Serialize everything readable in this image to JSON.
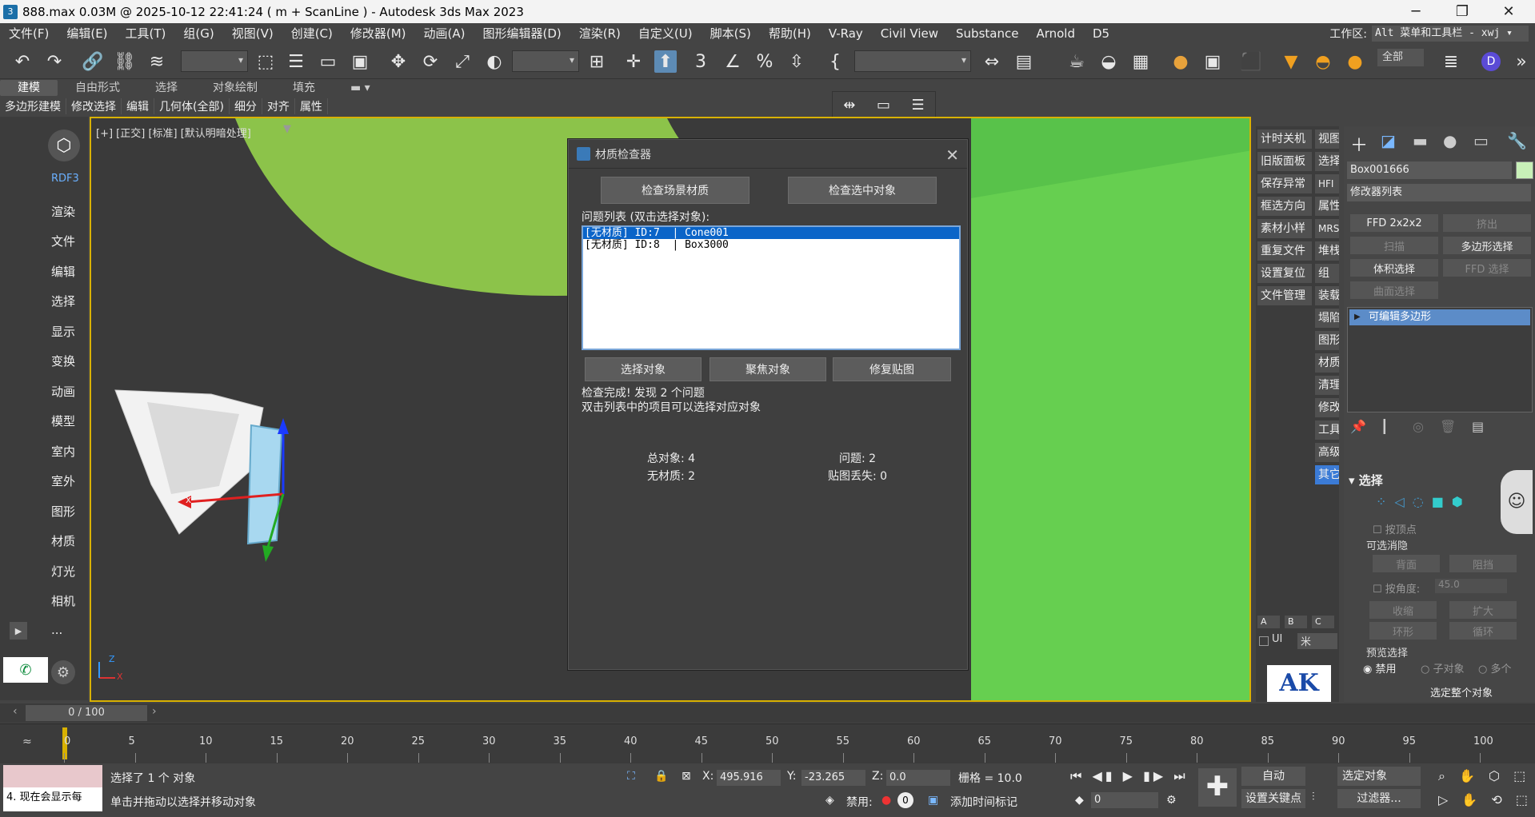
{
  "window": {
    "title": "888.max  0.03M @ 2025-10-12 22:41:24  ( m + ScanLine ) - Autodesk 3ds Max 2023",
    "minimize": "─",
    "maximize": "❐",
    "close": "✕"
  },
  "menu": {
    "items": [
      "文件(F)",
      "编辑(E)",
      "工具(T)",
      "组(G)",
      "视图(V)",
      "创建(C)",
      "修改器(M)",
      "动画(A)",
      "图形编辑器(D)",
      "渲染(R)",
      "自定义(U)",
      "脚本(S)",
      "帮助(H)",
      "V-Ray",
      "Civil View",
      "Substance",
      "Arnold",
      "D5"
    ],
    "workspace_label": "工作区:",
    "workspace_value": "Alt 菜单和工具栏 - xwj ▾"
  },
  "toolbar": {
    "all_label": "全部"
  },
  "ribbon": {
    "tabs": [
      "建模",
      "自由形式",
      "选择",
      "对象绘制",
      "填充"
    ],
    "sub_items": [
      "多边形建模",
      "修改选择",
      "编辑",
      "几何体(全部)",
      "细分",
      "对齐",
      "属性"
    ]
  },
  "left_panel": {
    "brand": "RDF3",
    "items": [
      "渲染",
      "文件",
      "编辑",
      "选择",
      "显示",
      "变换",
      "动画",
      "模型",
      "室内",
      "室外",
      "图形",
      "材质",
      "灯光",
      "相机",
      "..."
    ]
  },
  "viewport": {
    "label": "[+] [正交] [标准] [默认明暗处理]",
    "axis_x": "X",
    "axis_z": "Z",
    "gizmo_x": "x"
  },
  "dialog": {
    "title": "材质检查器",
    "close": "✕",
    "check_scene_button": "检查场景材质",
    "check_selected_button": "检查选中对象",
    "list_label": "问题列表 (双击选择对象):",
    "issues": [
      "[无材质] ID:7  | Cone001",
      "[无材质] ID:8  | Box3000"
    ],
    "select_button": "选择对象",
    "focus_button": "聚焦对象",
    "fix_button": "修复贴图",
    "status_line1": "检查完成! 发现 2 个问题",
    "status_line2": "双击列表中的项目可以选择对应对象",
    "total_objects": "总对象: 4",
    "issues_count": "问题: 2",
    "no_material": "无材质: 2",
    "missing_maps": "贴图丢失: 0"
  },
  "right_strip": {
    "col1": [
      "计时关机",
      "旧版面板",
      "保存异常",
      "框选方向",
      "素材小样",
      "重复文件",
      "设置复位",
      "文件管理"
    ],
    "col2": [
      "视图",
      "选择",
      "HFI",
      "属性",
      "MRS",
      "堆栈",
      "组",
      "装载",
      "塌陷",
      "图形",
      "材质",
      "清理",
      "修改",
      "工具",
      "高级",
      "其它"
    ],
    "abc": [
      "A",
      "B",
      "C"
    ],
    "ui_label": "UI",
    "unit": "米",
    "logo": "AK"
  },
  "command_panel": {
    "object_name": "Box001666",
    "modifier_list": "修改器列表",
    "modifier_buttons": [
      "FFD 2x2x2",
      "挤出",
      "扫描",
      "多边形选择",
      "体积选择",
      "FFD 选择",
      "曲面选择"
    ],
    "stack_item": "可编辑多边形",
    "selection_title": "选择",
    "by_vertex": "按顶点",
    "backface_group": "可选消隐",
    "backface": "背面",
    "occluded": "阻挡",
    "by_angle": "按角度:",
    "angle_value": "45.0",
    "shrink": "收缩",
    "grow": "扩大",
    "ring": "环形",
    "loop": "循环",
    "preview_title": "预览选择",
    "disable": "禁用",
    "subobject": "子对象",
    "multiple": "多个",
    "select_whole": "选定整个对象"
  },
  "timeline": {
    "frame": "0 / 100",
    "ticks": [
      "0",
      "5",
      "10",
      "15",
      "20",
      "25",
      "30",
      "35",
      "40",
      "45",
      "50",
      "55",
      "60",
      "65",
      "70",
      "75",
      "80",
      "85",
      "90",
      "95",
      "100"
    ]
  },
  "status": {
    "selected": "选择了 1 个 对象",
    "hint": "单击并拖动以选择并移动对象",
    "script_listener": "4. 现在会显示每",
    "x_label": "X:",
    "x_value": "495.916",
    "y_label": "Y:",
    "y_value": "-23.265",
    "z_label": "Z:",
    "z_value": "0.0",
    "grid": "栅格 = 10.0",
    "disabled_label": "禁用:",
    "disabled_value": "0",
    "add_time_tag": "添加时间标记",
    "auto": "自动",
    "set_key": "设置关键点",
    "selected_object": "选定对象",
    "filter": "过滤器...",
    "frame_field": "0"
  }
}
